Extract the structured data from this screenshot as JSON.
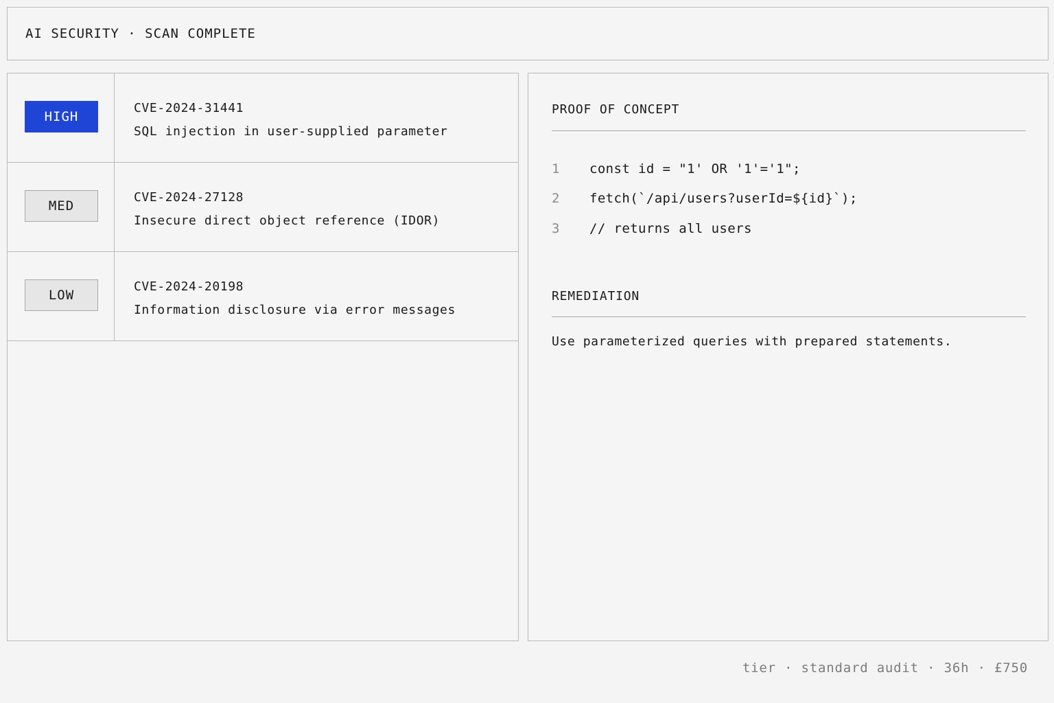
{
  "header": {
    "title": "AI SECURITY · SCAN COMPLETE"
  },
  "findings": [
    {
      "severity": "HIGH",
      "selected": true,
      "id": "CVE-2024-31441",
      "description": "SQL injection in user-supplied parameter"
    },
    {
      "severity": "MED",
      "selected": false,
      "id": "CVE-2024-27128",
      "description": "Insecure direct object reference (IDOR)"
    },
    {
      "severity": "LOW",
      "selected": false,
      "id": "CVE-2024-20198",
      "description": "Information disclosure via error messages"
    }
  ],
  "detail": {
    "poc_title": "PROOF OF CONCEPT",
    "code": [
      {
        "n": "1",
        "text": "const id = \"1' OR '1'='1\";"
      },
      {
        "n": "2",
        "text": "fetch(`/api/users?userId=${id}`);"
      },
      {
        "n": "3",
        "text": "// returns all users"
      }
    ],
    "remediation_title": "REMEDIATION",
    "remediation_text": "Use parameterized queries with prepared statements."
  },
  "footer": {
    "text": "tier · standard audit · 36h · £750"
  },
  "colors": {
    "accent": "#1f45d6",
    "border": "#b9b9bb",
    "background": "#f4f4f5"
  }
}
